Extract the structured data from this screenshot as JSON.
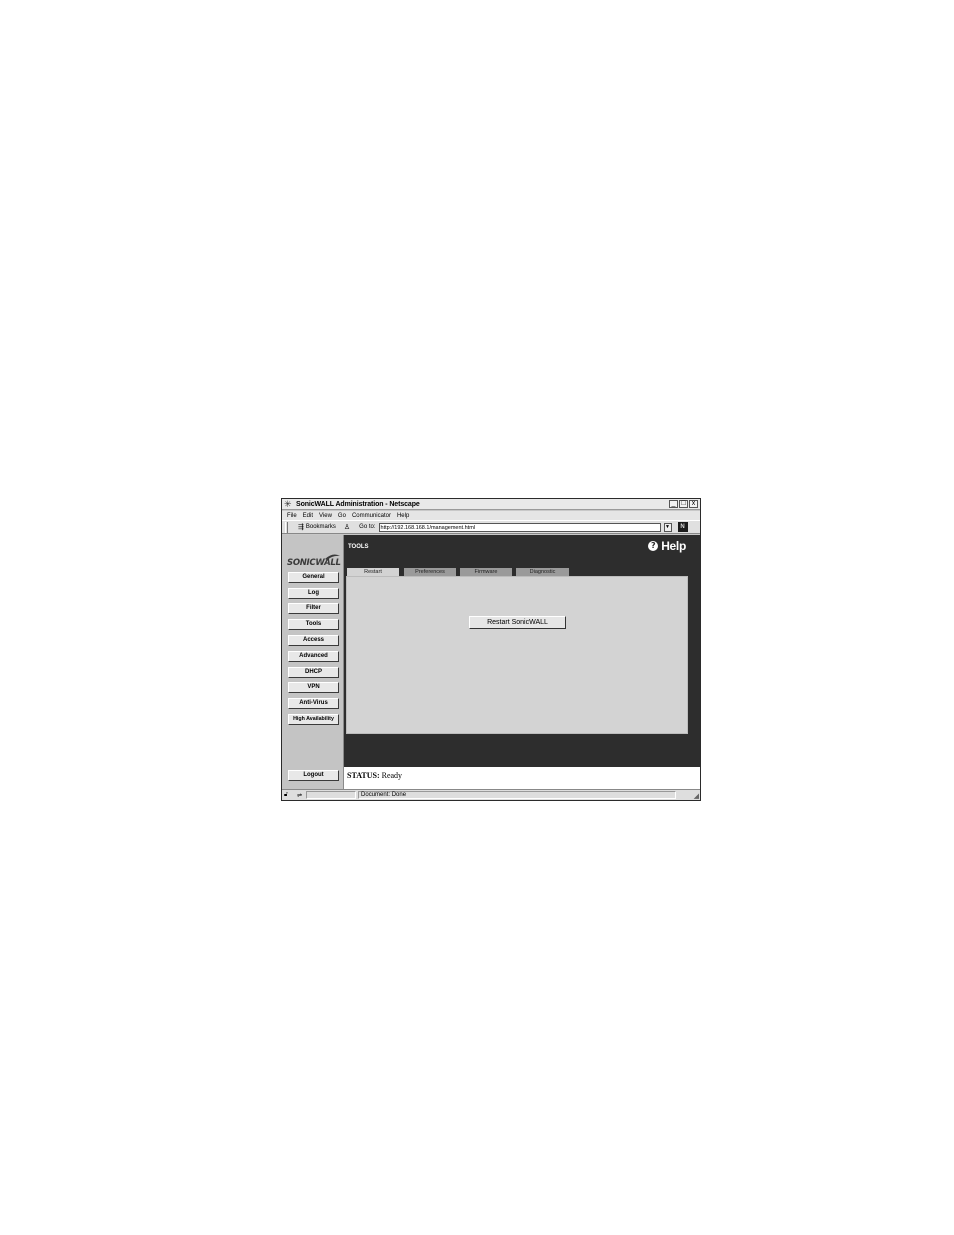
{
  "window": {
    "title": "SonicWALL Administration - Netscape",
    "controls": [
      "_",
      "□",
      "x"
    ]
  },
  "menu": [
    "File",
    "Edit",
    "View",
    "Go",
    "Communicator",
    "Help"
  ],
  "location_bar": {
    "bookmarks_label": "Bookmarks",
    "goto_label": "Go to:",
    "url": "http://192.168.168.1/management.html",
    "netscape_logo": "N"
  },
  "sidebar": {
    "logo": "SONICWALL",
    "items": [
      "General",
      "Log",
      "Filter",
      "Tools",
      "Access",
      "Advanced",
      "DHCP",
      "VPN",
      "Anti-Virus",
      "High Availability"
    ],
    "logout": "Logout"
  },
  "main": {
    "section_title": "TOOLS",
    "help_label": "Help",
    "tabs": [
      "Restart",
      "Preferences",
      "Firmware",
      "Diagnostic"
    ],
    "active_tab": "Restart",
    "restart_button": "Restart SonicWALL"
  },
  "status": {
    "label": "STATUS:",
    "value": "Ready"
  },
  "bottom_bar": {
    "document_status": "Document: Done"
  }
}
